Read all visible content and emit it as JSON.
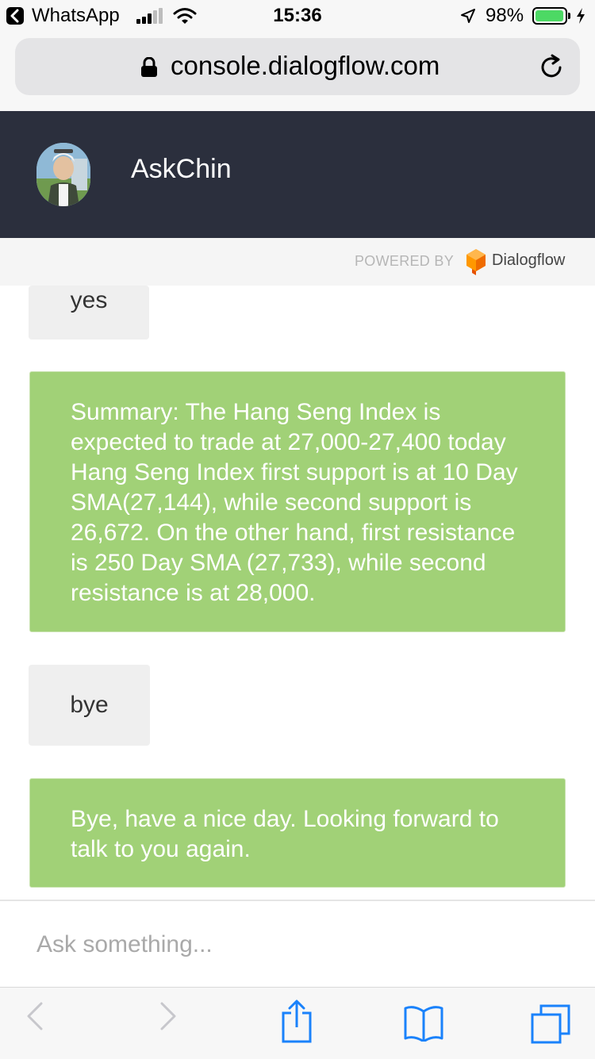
{
  "status_bar": {
    "back_app": "WhatsApp",
    "time": "15:36",
    "battery_percent": "98%",
    "battery_level": 0.98
  },
  "browser": {
    "url": "console.dialogflow.com"
  },
  "chat_header": {
    "bot_name": "AskChin"
  },
  "powered_by": {
    "label": "POWERED BY",
    "brand": "Dialogflow"
  },
  "messages": [
    {
      "role": "user",
      "text": "yes"
    },
    {
      "role": "bot",
      "text": "Summary: The Hang Seng Index is expected to trade at 27,000-27,400 today Hang Seng Index first support is at 10 Day SMA(27,144), while second support is 26,672. On the other hand, first resistance is 250 Day SMA (27,733), while second resistance is at 28,000."
    },
    {
      "role": "user",
      "text": "bye"
    },
    {
      "role": "bot",
      "text": "Bye, have a nice day. Looking forward to talk to you again."
    }
  ],
  "input": {
    "placeholder": "Ask something...",
    "value": ""
  },
  "colors": {
    "header_bg": "#2b2f3d",
    "bot_bubble": "#a1d177",
    "user_bubble": "#efefef",
    "ios_blue": "#1a82fb"
  },
  "toolbar": {
    "icons": [
      "back-arrow-icon",
      "forward-arrow-icon",
      "share-icon",
      "bookmarks-icon",
      "tabs-icon"
    ]
  }
}
